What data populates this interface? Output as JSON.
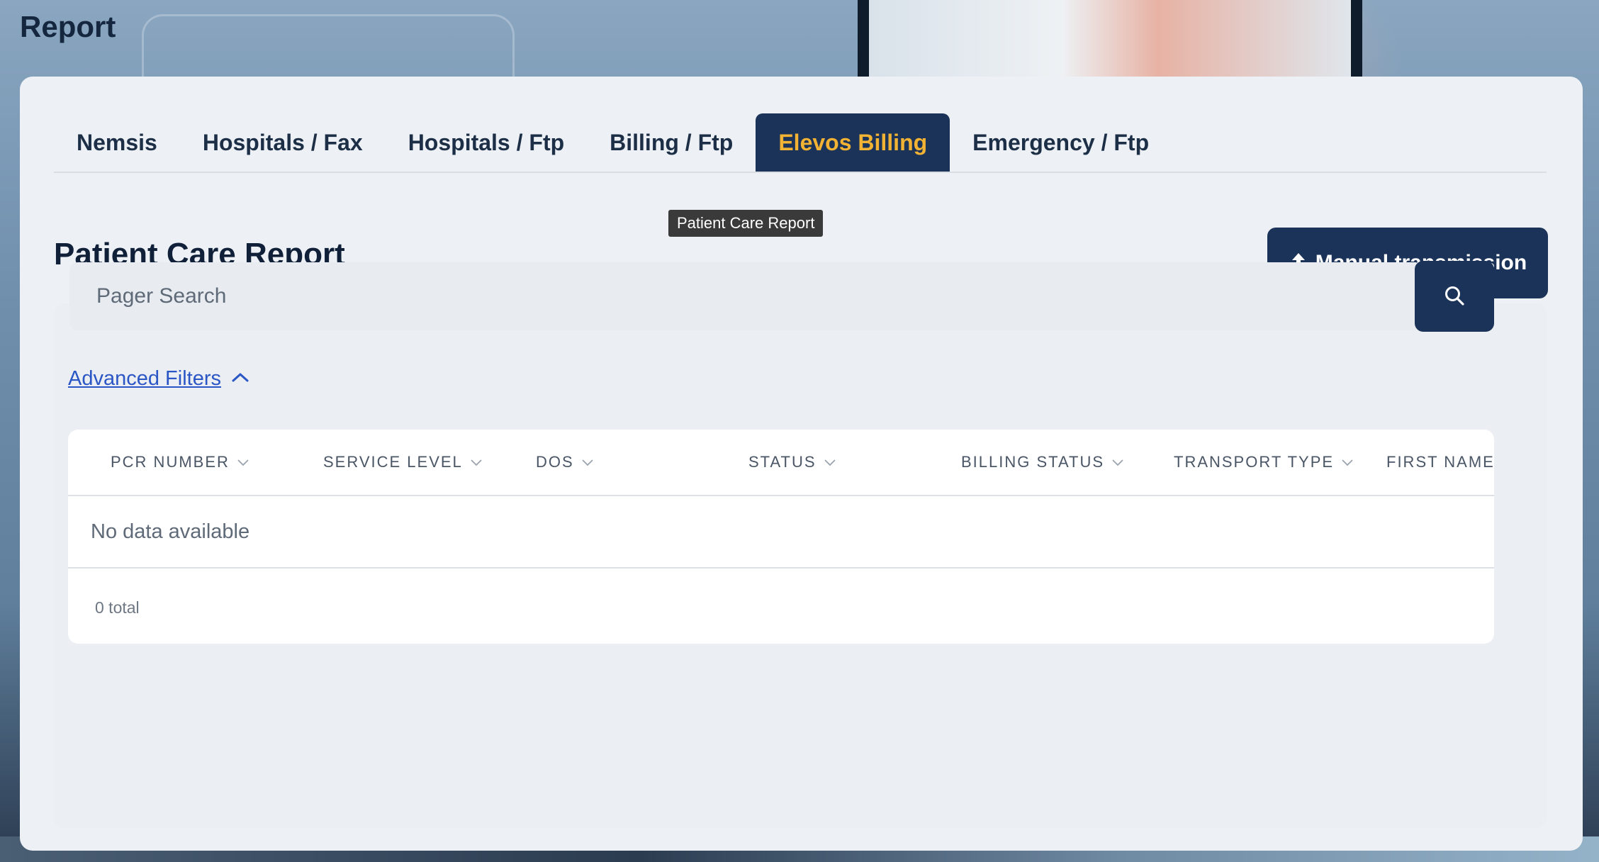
{
  "page": {
    "title": "Report"
  },
  "tabs": [
    {
      "label": "Nemsis",
      "active": false
    },
    {
      "label": "Hospitals / Fax",
      "active": false
    },
    {
      "label": "Hospitals / Ftp",
      "active": false
    },
    {
      "label": "Billing / Ftp",
      "active": false
    },
    {
      "label": "Elevos Billing",
      "active": true
    },
    {
      "label": "Emergency / Ftp",
      "active": false
    }
  ],
  "section": {
    "title": "Patient Care Report",
    "tooltip": "Patient Care Report"
  },
  "manual_button": {
    "label": "Manual transmission",
    "icon": "upload-icon"
  },
  "search": {
    "placeholder": "Pager Search",
    "value": "",
    "button_icon": "search-icon"
  },
  "filters": {
    "label": "Advanced Filters",
    "icon": "chevron-up-icon",
    "expanded": true
  },
  "table": {
    "columns": [
      "PCR NUMBER",
      "SERVICE LEVEL",
      "DOS",
      "STATUS",
      "BILLING STATUS",
      "TRANSPORT TYPE",
      "FIRST NAME"
    ],
    "empty_text": "No data available",
    "total_text": "0 total"
  },
  "colors": {
    "primary": "#1b3358",
    "active_tab_text": "#f2b233",
    "link": "#2b56c5",
    "card_bg": "#edf0f4"
  }
}
